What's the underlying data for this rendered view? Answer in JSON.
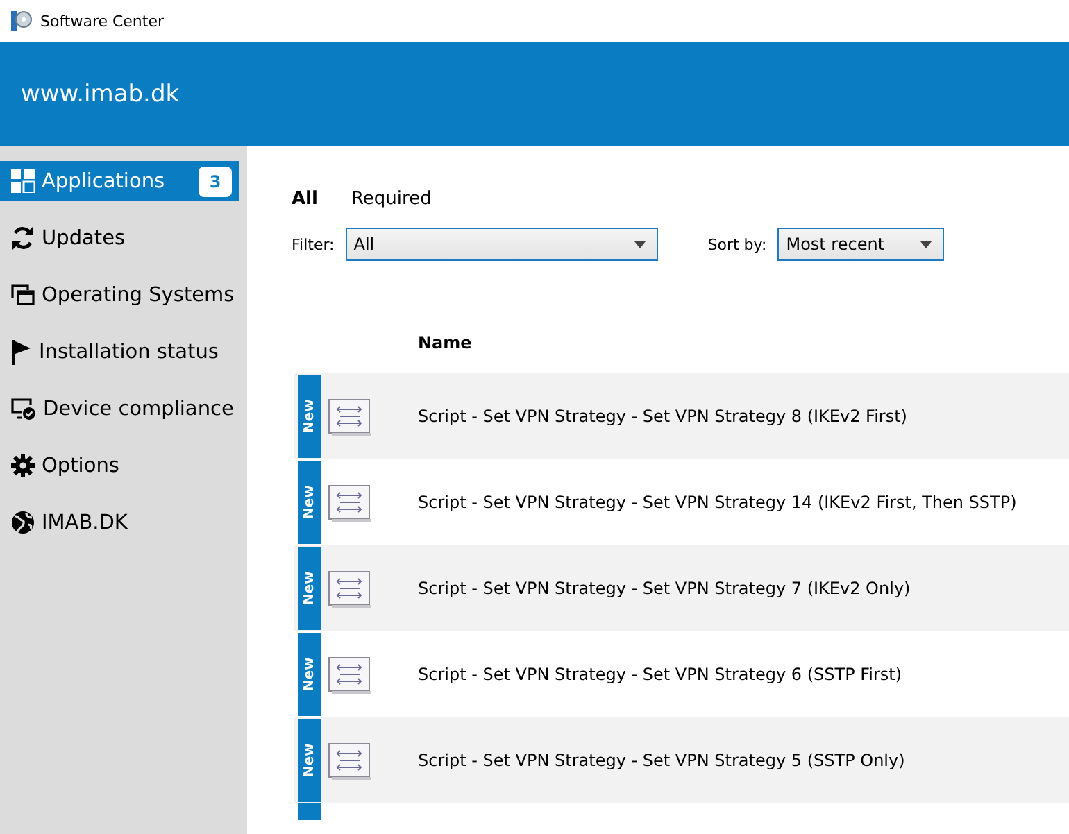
{
  "window": {
    "title": "Software Center"
  },
  "header": {
    "title": "www.imab.dk"
  },
  "sidebar": {
    "items": [
      {
        "label": "Applications",
        "kind": "apps",
        "selected": true,
        "count": "3"
      },
      {
        "label": "Updates",
        "kind": "updates",
        "selected": false
      },
      {
        "label": "Operating Systems",
        "kind": "os",
        "selected": false
      },
      {
        "label": "Installation status",
        "kind": "status",
        "selected": false
      },
      {
        "label": "Device compliance",
        "kind": "compliance",
        "selected": false
      },
      {
        "label": "Options",
        "kind": "options",
        "selected": false
      },
      {
        "label": "IMAB.DK",
        "kind": "link",
        "selected": false
      }
    ]
  },
  "tabs": [
    {
      "label": "All",
      "selected": true
    },
    {
      "label": "Required",
      "selected": false
    }
  ],
  "filter": {
    "label": "Filter:",
    "value": "All"
  },
  "sort": {
    "label": "Sort by:",
    "value": "Most recent"
  },
  "table": {
    "columns": [
      "Name"
    ],
    "rows": [
      {
        "kind": "app",
        "new": "New",
        "name": "Script - Set VPN Strategy - Set VPN Strategy 8 (IKEv2 First)"
      },
      {
        "kind": "app",
        "new": "New",
        "name": "Script - Set VPN Strategy - Set VPN Strategy 14 (IKEv2 First, Then SSTP)"
      },
      {
        "kind": "app",
        "new": "New",
        "name": "Script - Set VPN Strategy - Set VPN Strategy 7 (IKEv2 Only)"
      },
      {
        "kind": "app",
        "new": "New",
        "name": "Script - Set VPN Strategy - Set VPN Strategy 6 (SSTP First)"
      },
      {
        "kind": "app",
        "new": "New",
        "name": "Script - Set VPN Strategy - Set VPN Strategy 5 (SSTP Only)"
      },
      {
        "kind": "cut"
      }
    ]
  }
}
